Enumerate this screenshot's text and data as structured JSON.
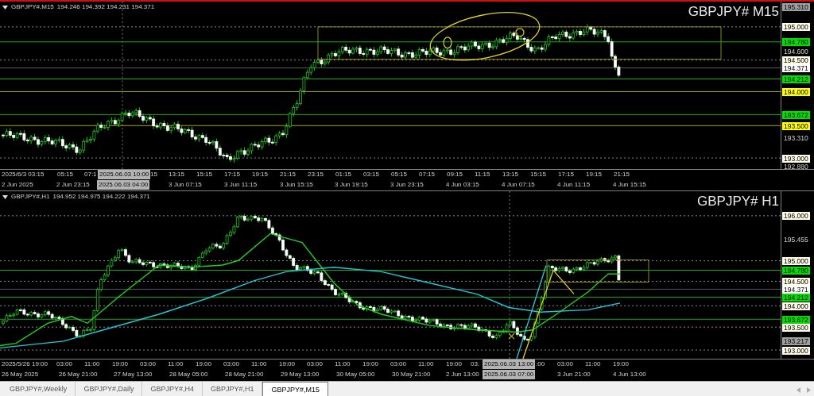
{
  "charts": [
    {
      "symbol": "GBPJPY#,M15",
      "ohlc": "194.246 194.392 194.231 194.371",
      "title": "GBPJPY# M15",
      "price_labels": [
        {
          "text": "195.310",
          "kind": "high"
        },
        {
          "text": "195.000",
          "kind": "level"
        },
        {
          "text": "194.780",
          "kind": "support"
        },
        {
          "text": "194.600",
          "kind": "tick"
        },
        {
          "text": "194.500",
          "kind": "level"
        },
        {
          "text": "194.371",
          "kind": "current"
        },
        {
          "text": "194.212",
          "kind": "support"
        },
        {
          "text": "194.000",
          "kind": "resistance"
        },
        {
          "text": "193.672",
          "kind": "support"
        },
        {
          "text": "193.500",
          "kind": "resistance"
        },
        {
          "text": "193.310",
          "kind": "tick"
        },
        {
          "text": "193.000",
          "kind": "level"
        },
        {
          "text": "192.880",
          "kind": "tick"
        }
      ],
      "time_row_1": [
        {
          "text": "2025/6/3 03:15",
          "kind": "tick"
        },
        {
          "text": "05:15",
          "kind": "tick"
        },
        {
          "text": "07:1",
          "kind": "tick"
        },
        {
          "text": "2025.06.03 10:00",
          "kind": "cursor"
        },
        {
          "text": "15",
          "kind": "tick"
        },
        {
          "text": "13:15",
          "kind": "tick"
        },
        {
          "text": "15:15",
          "kind": "tick"
        },
        {
          "text": "17:15",
          "kind": "tick"
        },
        {
          "text": "19:15",
          "kind": "tick"
        },
        {
          "text": "21:15",
          "kind": "tick"
        },
        {
          "text": "23:15",
          "kind": "tick"
        },
        {
          "text": "01:15",
          "kind": "tick"
        },
        {
          "text": "03:15",
          "kind": "tick"
        },
        {
          "text": "05:15",
          "kind": "tick"
        },
        {
          "text": "07:15",
          "kind": "tick"
        },
        {
          "text": "09:15",
          "kind": "tick"
        },
        {
          "text": "11:15",
          "kind": "tick"
        },
        {
          "text": "13:15",
          "kind": "tick"
        },
        {
          "text": "15:15",
          "kind": "tick"
        },
        {
          "text": "17:15",
          "kind": "tick"
        },
        {
          "text": "19:15",
          "kind": "tick"
        },
        {
          "text": "21:15",
          "kind": "tick"
        }
      ],
      "time_row_2": [
        {
          "text": "2 Jun 2025",
          "kind": "tick"
        },
        {
          "text": "2 Jun 23:15",
          "kind": "tick"
        },
        {
          "text": "2025.06.03 04:00",
          "kind": "cursor"
        },
        {
          "text": "3 Jun 07:15",
          "kind": "tick"
        },
        {
          "text": "3 Jun 11:15",
          "kind": "tick"
        },
        {
          "text": "3 Jun 15:15",
          "kind": "tick"
        },
        {
          "text": "3 Jun 19:15",
          "kind": "tick"
        },
        {
          "text": "3 Jun 23:15",
          "kind": "tick"
        },
        {
          "text": "4 Jun 03:15",
          "kind": "tick"
        },
        {
          "text": "4 Jun 07:15",
          "kind": "tick"
        },
        {
          "text": "4 Jun 11:15",
          "kind": "tick"
        },
        {
          "text": "4 Jun 15:15",
          "kind": "tick"
        }
      ]
    },
    {
      "symbol": "GBPJPY#,H1",
      "ohlc": "194.952 194.975 194.222 194.371",
      "title": "GBPJPY# H1",
      "price_labels": [
        {
          "text": "196.000",
          "kind": "level"
        },
        {
          "text": "195.455",
          "kind": "tick"
        },
        {
          "text": "195.000",
          "kind": "level"
        },
        {
          "text": "194.780",
          "kind": "support"
        },
        {
          "text": "194.500",
          "kind": "level"
        },
        {
          "text": "194.371",
          "kind": "current"
        },
        {
          "text": "194.212",
          "kind": "support"
        },
        {
          "text": "194.000",
          "kind": "level"
        },
        {
          "text": "193.672",
          "kind": "support"
        },
        {
          "text": "193.500",
          "kind": "level"
        },
        {
          "text": "193.217",
          "kind": "high"
        },
        {
          "text": "193.000",
          "kind": "level"
        }
      ],
      "time_row_1": [
        {
          "text": "2025/5/26",
          "kind": "tick"
        },
        {
          "text": "19:00",
          "kind": "tick"
        },
        {
          "text": "03:00",
          "kind": "tick"
        },
        {
          "text": "11:00",
          "kind": "tick"
        },
        {
          "text": "19:00",
          "kind": "tick"
        },
        {
          "text": "03:00",
          "kind": "tick"
        },
        {
          "text": "11:00",
          "kind": "tick"
        },
        {
          "text": "19:00",
          "kind": "tick"
        },
        {
          "text": "03:00",
          "kind": "tick"
        },
        {
          "text": "11:00",
          "kind": "tick"
        },
        {
          "text": "19:00",
          "kind": "tick"
        },
        {
          "text": "03:00",
          "kind": "tick"
        },
        {
          "text": "11:00",
          "kind": "tick"
        },
        {
          "text": "19:00",
          "kind": "tick"
        },
        {
          "text": "03:00",
          "kind": "tick"
        },
        {
          "text": "11:00",
          "kind": "tick"
        },
        {
          "text": "19:00",
          "kind": "tick"
        },
        {
          "text": "03:",
          "kind": "tick"
        },
        {
          "text": "2025.06.03 13:00",
          "kind": "cursor"
        },
        {
          "text": ":00",
          "kind": "tick"
        },
        {
          "text": "03:00",
          "kind": "tick"
        },
        {
          "text": "11:00",
          "kind": "tick"
        },
        {
          "text": "19:00",
          "kind": "tick"
        }
      ],
      "time_row_2": [
        {
          "text": "26 May 2025",
          "kind": "tick"
        },
        {
          "text": "26 May 21:00",
          "kind": "tick"
        },
        {
          "text": "27 May 13:00",
          "kind": "tick"
        },
        {
          "text": "28 May 05:00",
          "kind": "tick"
        },
        {
          "text": "28 May 21:00",
          "kind": "tick"
        },
        {
          "text": "29 May 13:00",
          "kind": "tick"
        },
        {
          "text": "30 May 05:00",
          "kind": "tick"
        },
        {
          "text": "30 May 21:00",
          "kind": "tick"
        },
        {
          "text": "2 Jun 13:00",
          "kind": "tick"
        },
        {
          "text": "2025.06.03 07:00",
          "kind": "cursor"
        },
        {
          "text": "3 Jun 21:00",
          "kind": "tick"
        },
        {
          "text": "4 Jun 13:00",
          "kind": "tick"
        }
      ]
    }
  ],
  "tabs": [
    {
      "label": "GBPJPY#,Weekly",
      "selected": false
    },
    {
      "label": "GBPJPY#,Daily",
      "selected": false
    },
    {
      "label": "GBPJPY#,H4",
      "selected": false
    },
    {
      "label": "GBPJPY#,H1",
      "selected": false
    },
    {
      "label": "GBPJPY#,M15",
      "selected": true
    }
  ]
}
